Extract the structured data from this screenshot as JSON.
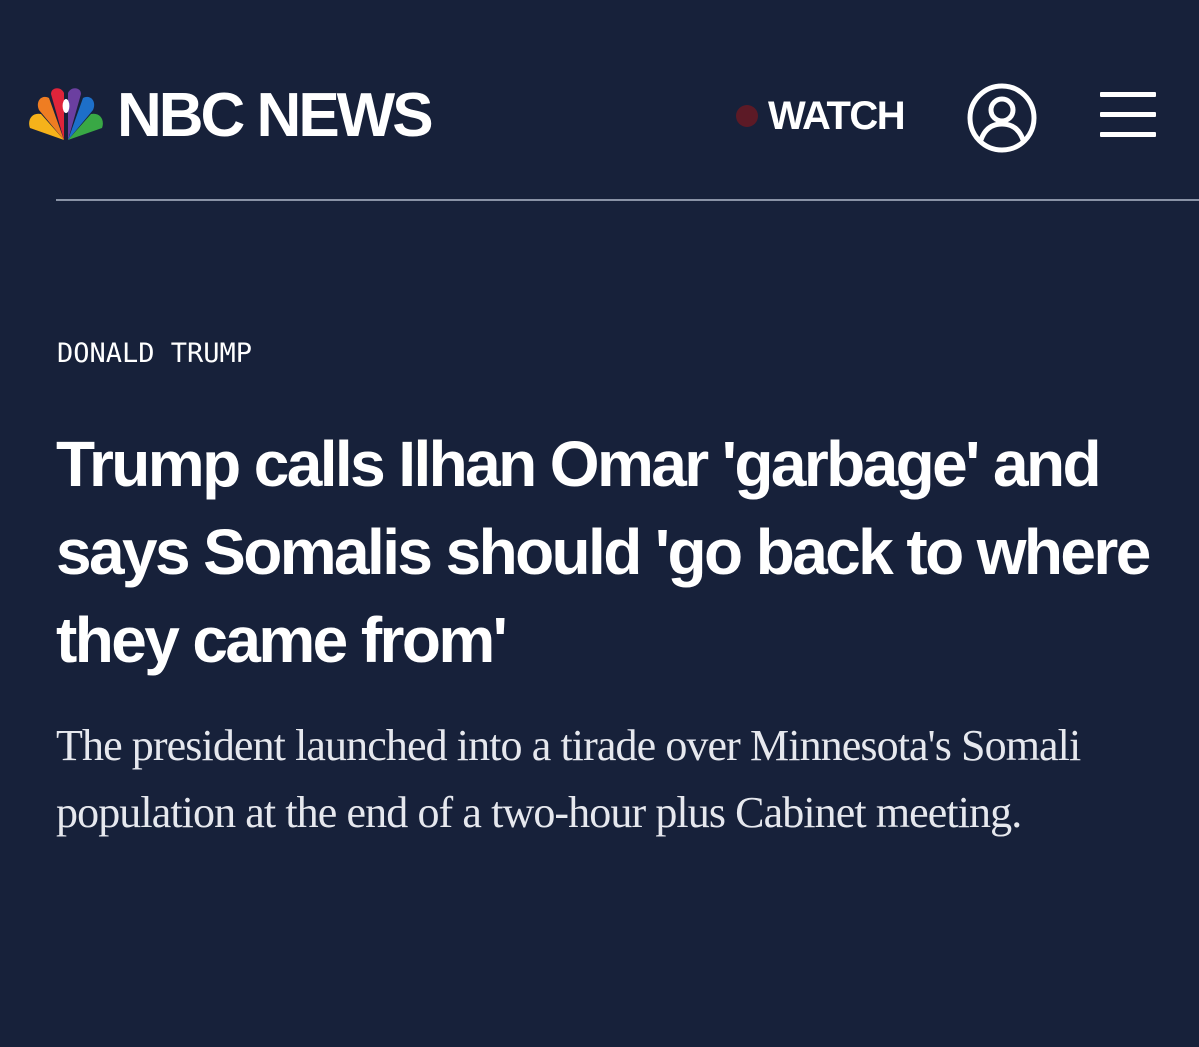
{
  "header": {
    "logo_text": "NBC NEWS",
    "watch_label": "WATCH",
    "icons": {
      "logo": "nbc-peacock-icon",
      "live": "live-dot-icon",
      "account": "user-account-icon",
      "menu": "hamburger-menu-icon"
    }
  },
  "article": {
    "eyebrow": "DONALD TRUMP",
    "headline": "Trump calls Ilhan Omar 'garbage' and says Somalis should 'go back to where they came from'",
    "dek": "The president launched into a tirade over Minnesota's Somali population at the end of a two-hour plus Cabinet meeting."
  },
  "colors": {
    "background": "#17213a",
    "text": "#ffffff",
    "divider": "#8a93a6",
    "live_dot": "#5c1a26",
    "peacock": [
      "#f6b21a",
      "#ef7d22",
      "#e0243a",
      "#6b3fa0",
      "#1d6fc9",
      "#39a845"
    ]
  }
}
